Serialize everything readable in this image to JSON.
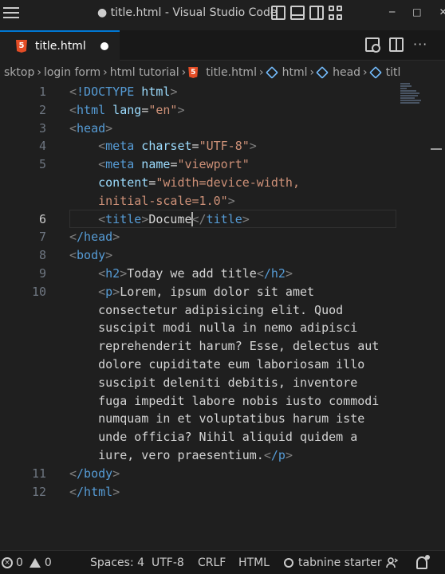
{
  "window": {
    "title": "● title.html - Visual Studio Code",
    "minimize": "─",
    "maximize": "□",
    "close": "✕"
  },
  "tab": {
    "label": "title.html",
    "icon_text": "5"
  },
  "breadcrumb": {
    "items": [
      "sktop",
      "login form",
      "html tutorial",
      "title.html",
      "html",
      "head",
      "titl"
    ]
  },
  "editor": {
    "line_numbers": [
      "1",
      "2",
      "3",
      "4",
      "5",
      "",
      "",
      "6",
      "7",
      "8",
      "9",
      "10",
      "",
      "",
      "",
      "",
      "",
      "",
      "",
      "",
      "",
      "11",
      "12"
    ],
    "lines": {
      "l1": "<!DOCTYPE html>",
      "l2_open": "<",
      "l2_tag": "html",
      "l2_attr": " lang",
      "l2_eq": "=",
      "l2_val": "\"en\"",
      "l2_close": ">",
      "l3_tag": "head",
      "l4_tag": "meta",
      "l4_attr": " charset",
      "l4_val": "\"UTF-8\"",
      "l5_tag": "meta",
      "l5_attr": " name",
      "l5_val": "\"viewport\"",
      "l5b_attr": "content",
      "l5b_val": "\"width=device-width,",
      "l5c_val": "initial-scale=1.0\"",
      "l6_tag": "title",
      "l6_text": "Docume",
      "l6_close_tag": "title",
      "l7_tag": "/head",
      "l8_tag": "body",
      "l9_tag": "h2",
      "l9_text": "Today we add title",
      "l9_close": "/h2",
      "l10_tag": "p",
      "l10_text_1": "Lorem, ipsum dolor sit amet",
      "l10_text_2": "consectetur adipisicing elit. Quod",
      "l10_text_3": "suscipit modi nulla in nemo adipisci",
      "l10_text_4": "reprehenderit harum? Esse, delectus aut",
      "l10_text_5": "dolore cupiditate eum laboriosam illo",
      "l10_text_6": "suscipit deleniti debitis, inventore",
      "l10_text_7": "fuga impedit labore nobis iusto commodi",
      "l10_text_8": "numquam in et voluptatibus harum iste",
      "l10_text_9": "unde officia? Nihil aliquid quidem a",
      "l10_text_10": "iure, vero praesentium.",
      "l10_close": "/p",
      "l11_tag": "/body",
      "l12_tag": "/html"
    }
  },
  "status": {
    "errors": "0",
    "warnings": "0",
    "spaces": "Spaces: 4",
    "encoding": "UTF-8",
    "eol": "CRLF",
    "language": "HTML",
    "tabnine": "tabnine starter"
  },
  "colors": {
    "tag": "#569cd6",
    "attr": "#9cdcfe",
    "string": "#ce9178",
    "accent": "#0078d4"
  }
}
